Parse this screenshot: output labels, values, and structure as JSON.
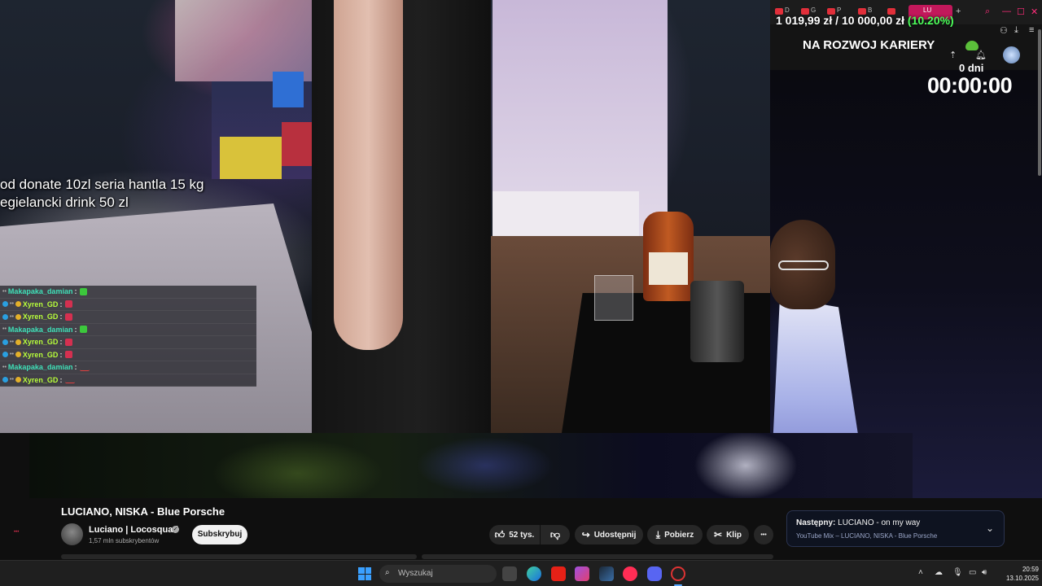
{
  "stream": {
    "text_line1": "od donate 10zl seria hantla 15 kg",
    "text_line2": "egielancki drink 50 zl"
  },
  "chat": {
    "messages": [
      {
        "user": "Makapaka_damian",
        "color": "teal",
        "emote": "green"
      },
      {
        "user": "Xyren_GD",
        "color": "lime",
        "emote": "red"
      },
      {
        "user": "Xyren_GD",
        "color": "lime",
        "emote": "red"
      },
      {
        "user": "Makapaka_damian",
        "color": "teal",
        "emote": "green"
      },
      {
        "user": "Xyren_GD",
        "color": "lime",
        "emote": "red"
      },
      {
        "user": "Xyren_GD",
        "color": "lime",
        "emote": "red"
      },
      {
        "user": "Makapaka_damian",
        "color": "teal",
        "emote": "line"
      },
      {
        "user": "Xyren_GD",
        "color": "lime",
        "emote": "line"
      }
    ]
  },
  "overlay": {
    "tabs": [
      "D",
      "G",
      "P",
      "B",
      "LU"
    ],
    "goal_amount": "1 019,99 zł / 10 000,00 zł",
    "goal_percent": "(10.20%)",
    "goal_title": "NA ROZWOJ KARIERY",
    "days": "0 dni",
    "timer": "00:00:00"
  },
  "video": {
    "title": "LUCIANO, NISKA - Blue Porsche",
    "channel": "Luciano | Locosquad",
    "subscribers": "1,57 mln subskrybentów",
    "subscribe_label": "Subskrybuj",
    "likes": "52 tys.",
    "share_label": "Udostępnij",
    "download_label": "Pobierz",
    "clip_label": "Klip",
    "more_label": "•••",
    "next_prefix": "Następny:",
    "next_title": "LUCIANO - on my way",
    "next_sub": "YouTube Mix – LUCIANO, NISKA - Blue Porsche"
  },
  "taskbar": {
    "search_placeholder": "Wyszukaj",
    "time": "20:59",
    "date": "13.10.2025"
  },
  "colors": {
    "accent_red": "#e12f3a",
    "goal_green": "#4cff5a",
    "windows_blue": "#3aa0ff"
  }
}
